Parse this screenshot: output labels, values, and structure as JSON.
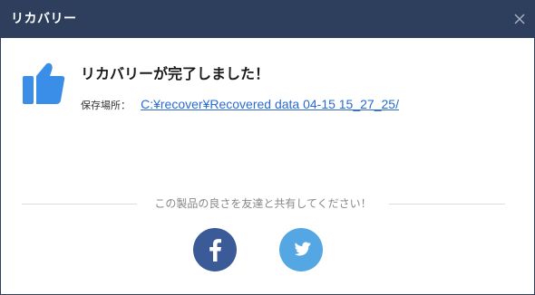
{
  "window": {
    "title": "リカバリー",
    "close_icon": "close-icon"
  },
  "colors": {
    "titlebar": "#2d3f5c",
    "accent": "#2a6ad1",
    "thumb": "#3b8ee8",
    "facebook": "#3b5a98",
    "twitter": "#55a7e3"
  },
  "main": {
    "icon": "thumbs-up-icon",
    "heading": "リカバリーが完了しました！",
    "save_label": "保存場所：",
    "save_path": "C:¥recover¥Recovered data 04-15 15_27_25/"
  },
  "share": {
    "text": "この製品の良さを友達と共有してください！",
    "buttons": [
      {
        "icon": "facebook-icon"
      },
      {
        "icon": "twitter-icon"
      }
    ]
  }
}
